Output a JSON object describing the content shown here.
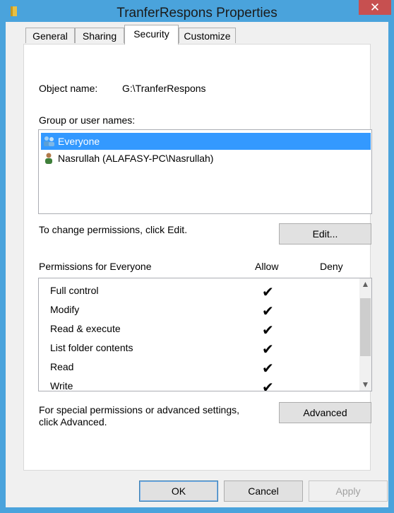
{
  "window": {
    "title": "TranferRespons Properties",
    "close_glyph": "✕",
    "accent_color": "#4aa3dc"
  },
  "tabs": [
    {
      "label": "General"
    },
    {
      "label": "Sharing"
    },
    {
      "label": "Security",
      "active": true
    },
    {
      "label": "Customize"
    }
  ],
  "security": {
    "object_name_label": "Object name:",
    "object_name_value": "G:\\TranferRespons",
    "group_label": "Group or user names:",
    "users": [
      {
        "name": "Everyone",
        "icon": "users-group-icon",
        "selected": true
      },
      {
        "name": "Nasrullah (ALAFASY-PC\\Nasrullah)",
        "icon": "user-icon",
        "selected": false
      }
    ],
    "change_hint": "To change permissions, click Edit.",
    "edit_button": "Edit...",
    "permissions_label": "Permissions for Everyone",
    "allow_header": "Allow",
    "deny_header": "Deny",
    "permissions": [
      {
        "name": "Full control",
        "allow": "✔",
        "deny": ""
      },
      {
        "name": "Modify",
        "allow": "✔",
        "deny": ""
      },
      {
        "name": "Read & execute",
        "allow": "✔",
        "deny": ""
      },
      {
        "name": "List folder contents",
        "allow": "✔",
        "deny": ""
      },
      {
        "name": "Read",
        "allow": "✔",
        "deny": ""
      },
      {
        "name": "Write",
        "allow": "✔",
        "deny": ""
      }
    ],
    "advanced_hint_line1": "For special permissions or advanced settings,",
    "advanced_hint_line2": "click Advanced.",
    "advanced_button": "Advanced"
  },
  "footer": {
    "ok": "OK",
    "cancel": "Cancel",
    "apply": "Apply"
  }
}
